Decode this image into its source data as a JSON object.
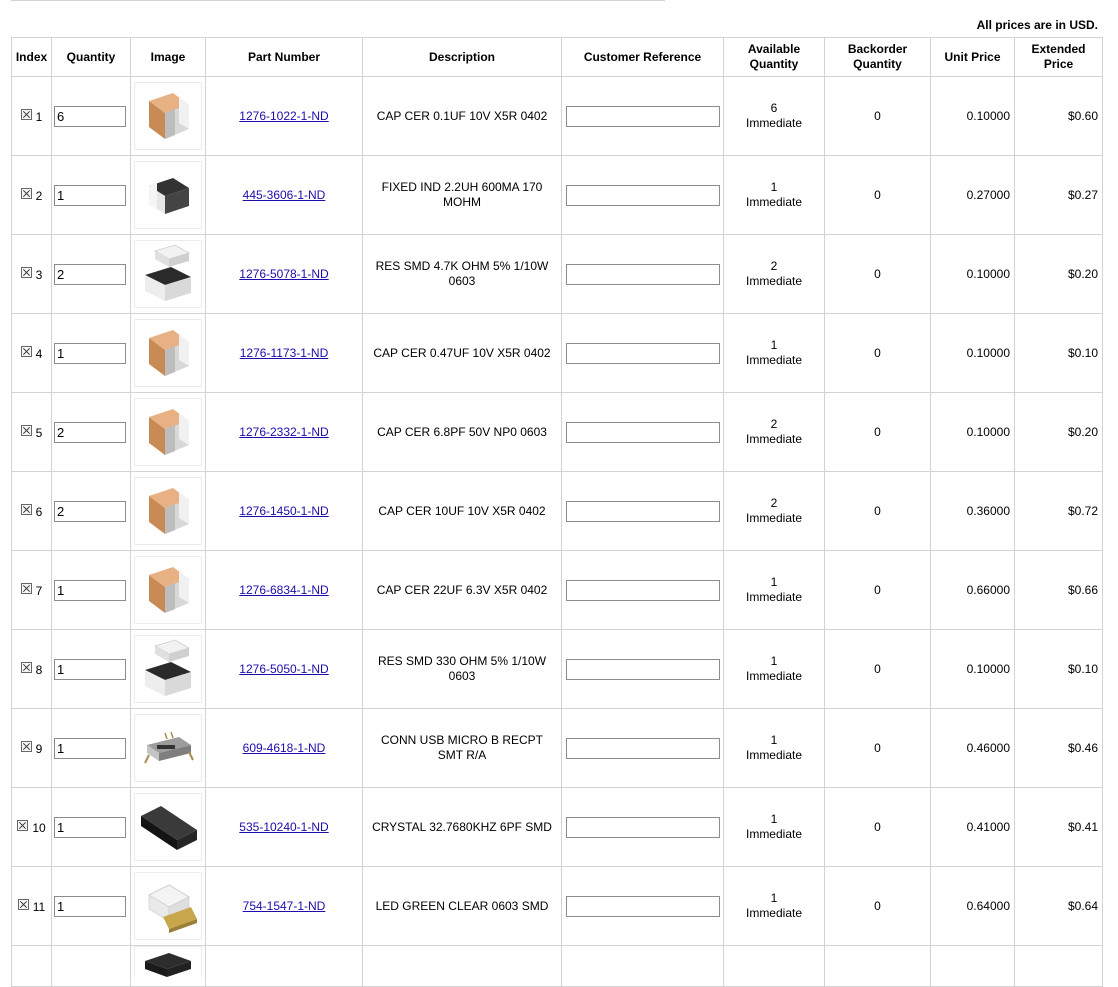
{
  "price_note": "All prices are in USD.",
  "headers": {
    "index": "Index",
    "quantity": "Quantity",
    "image": "Image",
    "part_number": "Part Number",
    "description": "Description",
    "customer_reference": "Customer Reference",
    "available_1": "Available",
    "available_2": "Quantity",
    "backorder_1": "Backorder",
    "backorder_2": "Quantity",
    "unit_price": "Unit Price",
    "extended_1": "Extended",
    "extended_2": "Price"
  },
  "rows": [
    {
      "index": "1",
      "qty": "6",
      "img": "cap",
      "part": "1276-1022-1-ND",
      "desc": "CAP CER 0.1UF 10V X5R 0402",
      "avail": "6",
      "avail_status": "Immediate",
      "backorder": "0",
      "unit": "0.10000",
      "ext": "$0.60"
    },
    {
      "index": "2",
      "qty": "1",
      "img": "ind",
      "part": "445-3606-1-ND",
      "desc": "FIXED IND 2.2UH 600MA 170 MOHM",
      "avail": "1",
      "avail_status": "Immediate",
      "backorder": "0",
      "unit": "0.27000",
      "ext": "$0.27"
    },
    {
      "index": "3",
      "qty": "2",
      "img": "res",
      "part": "1276-5078-1-ND",
      "desc": "RES SMD 4.7K OHM 5% 1/10W 0603",
      "avail": "2",
      "avail_status": "Immediate",
      "backorder": "0",
      "unit": "0.10000",
      "ext": "$0.20"
    },
    {
      "index": "4",
      "qty": "1",
      "img": "cap",
      "part": "1276-1173-1-ND",
      "desc": "CAP CER 0.47UF 10V X5R 0402",
      "avail": "1",
      "avail_status": "Immediate",
      "backorder": "0",
      "unit": "0.10000",
      "ext": "$0.10"
    },
    {
      "index": "5",
      "qty": "2",
      "img": "cap",
      "part": "1276-2332-1-ND",
      "desc": "CAP CER 6.8PF 50V NP0 0603",
      "avail": "2",
      "avail_status": "Immediate",
      "backorder": "0",
      "unit": "0.10000",
      "ext": "$0.20"
    },
    {
      "index": "6",
      "qty": "2",
      "img": "cap",
      "part": "1276-1450-1-ND",
      "desc": "CAP CER 10UF 10V X5R 0402",
      "avail": "2",
      "avail_status": "Immediate",
      "backorder": "0",
      "unit": "0.36000",
      "ext": "$0.72"
    },
    {
      "index": "7",
      "qty": "1",
      "img": "cap",
      "part": "1276-6834-1-ND",
      "desc": "CAP CER 22UF 6.3V X5R 0402",
      "avail": "1",
      "avail_status": "Immediate",
      "backorder": "0",
      "unit": "0.66000",
      "ext": "$0.66"
    },
    {
      "index": "8",
      "qty": "1",
      "img": "res",
      "part": "1276-5050-1-ND",
      "desc": "RES SMD 330 OHM 5% 1/10W 0603",
      "avail": "1",
      "avail_status": "Immediate",
      "backorder": "0",
      "unit": "0.10000",
      "ext": "$0.10"
    },
    {
      "index": "9",
      "qty": "1",
      "img": "usb",
      "part": "609-4618-1-ND",
      "desc": "CONN USB MICRO B RECPT SMT R/A",
      "avail": "1",
      "avail_status": "Immediate",
      "backorder": "0",
      "unit": "0.46000",
      "ext": "$0.46"
    },
    {
      "index": "10",
      "qty": "1",
      "img": "crystal",
      "part": "535-10240-1-ND",
      "desc": "CRYSTAL 32.7680KHZ 6PF SMD",
      "avail": "1",
      "avail_status": "Immediate",
      "backorder": "0",
      "unit": "0.41000",
      "ext": "$0.41"
    },
    {
      "index": "11",
      "qty": "1",
      "img": "led",
      "part": "754-1547-1-ND",
      "desc": "LED GREEN CLEAR 0603 SMD",
      "avail": "1",
      "avail_status": "Immediate",
      "backorder": "0",
      "unit": "0.64000",
      "ext": "$0.64"
    }
  ],
  "icons": {
    "delete": "close-box-icon",
    "cap": "ceramic-capacitor-icon",
    "ind": "inductor-icon",
    "res": "resistor-icon",
    "usb": "usb-connector-icon",
    "crystal": "crystal-icon",
    "led": "led-icon"
  },
  "colors": {
    "link": "#1a0dab",
    "border": "#d3d3d3",
    "cap_body": "#d69a63",
    "cap_terminal": "#e8e8e8"
  }
}
